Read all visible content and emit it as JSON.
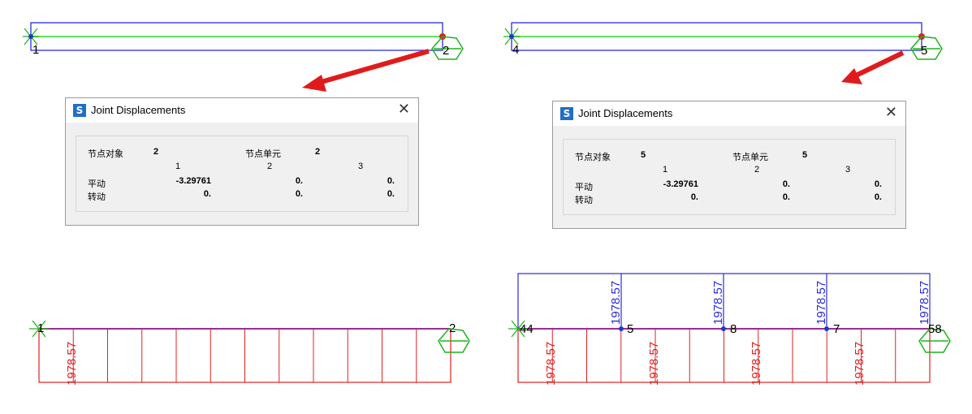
{
  "colors": {
    "frame": "#2b2bd9",
    "axis": "#5ee65e",
    "support": "#1fb31f",
    "moment": "#e02020",
    "arrow": "#e11b1b",
    "node": "#1a3cc7"
  },
  "top_left": {
    "node_start": "1",
    "node_end": "2"
  },
  "top_right": {
    "node_start": "4",
    "node_end": "5"
  },
  "dialog_left": {
    "title": "Joint Displacements",
    "joint_label": "节点对象",
    "joint_value": "2",
    "element_label": "节点单元",
    "element_value": "2",
    "col1": "1",
    "col2": "2",
    "col3": "3",
    "row1_label": "平动",
    "row1_v1": "-3.29761",
    "row1_v2": "0.",
    "row1_v3": "0.",
    "row2_label": "转动",
    "row2_v1": "0.",
    "row2_v2": "0.",
    "row2_v3": "0."
  },
  "dialog_right": {
    "title": "Joint Displacements",
    "joint_label": "节点对象",
    "joint_value": "5",
    "element_label": "节点单元",
    "element_value": "5",
    "col1": "1",
    "col2": "2",
    "col3": "3",
    "row1_label": "平动",
    "row1_v1": "-3.29761",
    "row1_v2": "0.",
    "row1_v3": "0.",
    "row2_label": "转动",
    "row2_v1": "0.",
    "row2_v2": "0.",
    "row2_v3": "0."
  },
  "bottom_left": {
    "node_start": "1",
    "node_end": "2",
    "moment_label": "1978.57"
  },
  "bottom_right": {
    "node_a": "44",
    "node_b": "5",
    "node_c": "8",
    "node_d": "7",
    "node_e": "58",
    "moment_label": "1978.57"
  }
}
